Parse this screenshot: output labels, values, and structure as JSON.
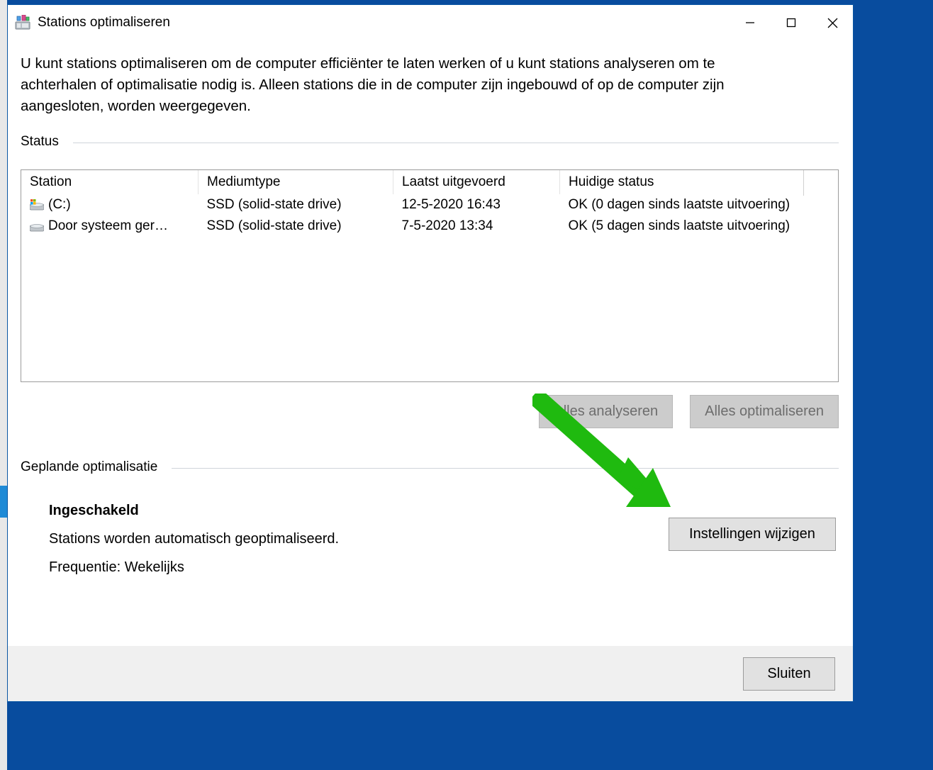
{
  "window": {
    "title": "Stations optimaliseren"
  },
  "description": "U kunt stations optimaliseren om de computer efficiënter te laten werken of u kunt stations analyseren om te achterhalen of optimalisatie nodig is. Alleen stations die in de computer zijn ingebouwd of op de computer zijn aangesloten, worden weergegeven.",
  "status_section_label": "Status",
  "table": {
    "headers": {
      "station": "Station",
      "media_type": "Mediumtype",
      "last_run": "Laatst uitgevoerd",
      "current_status": "Huidige status"
    },
    "rows": [
      {
        "station": "(C:)",
        "has_win_badge": true,
        "media_type": "SSD (solid-state drive)",
        "last_run": "12-5-2020 16:43",
        "current_status": "OK (0 dagen sinds laatste uitvoering)"
      },
      {
        "station": "Door systeem ger…",
        "has_win_badge": false,
        "media_type": "SSD (solid-state drive)",
        "last_run": "7-5-2020 13:34",
        "current_status": "OK (5 dagen sinds laatste uitvoering)"
      }
    ]
  },
  "buttons": {
    "analyze_all": "Alles analyseren",
    "optimize_all": "Alles optimaliseren",
    "change_settings": "Instellingen wijzigen",
    "close": "Sluiten"
  },
  "scheduled_section_label": "Geplande optimalisatie",
  "scheduled": {
    "enabled_label": "Ingeschakeld",
    "auto_text": "Stations worden automatisch geoptimaliseerd.",
    "frequency_text": "Frequentie: Wekelijks"
  },
  "annotation": {
    "arrow_color": "#1fba0f"
  }
}
